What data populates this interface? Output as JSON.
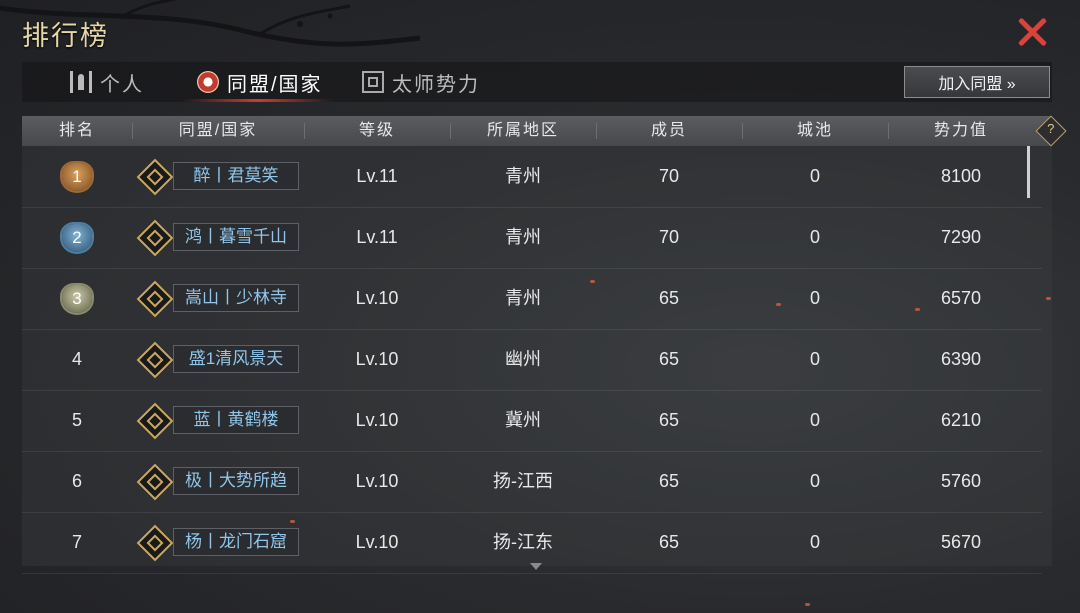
{
  "header": {
    "title": "排行榜"
  },
  "tabs": [
    {
      "label": "个人",
      "icon": "pagoda-icon",
      "active": false
    },
    {
      "label": "同盟/国家",
      "icon": "alliance-emblem-icon",
      "active": true
    },
    {
      "label": "太师势力",
      "icon": "seal-icon",
      "active": false
    }
  ],
  "join_button": {
    "label": "加入同盟 »"
  },
  "help": {
    "label": "?"
  },
  "columns": [
    "排名",
    "同盟/国家",
    "等级",
    "所属地区",
    "成员",
    "城池",
    "势力值"
  ],
  "rows": [
    {
      "rank": "1",
      "name": "醉丨君莫笑",
      "level": "Lv.11",
      "region": "青州",
      "members": "70",
      "cities": "0",
      "power": "8100"
    },
    {
      "rank": "2",
      "name": "鸿丨暮雪千山",
      "level": "Lv.11",
      "region": "青州",
      "members": "70",
      "cities": "0",
      "power": "7290"
    },
    {
      "rank": "3",
      "name": "嵩山丨少林寺",
      "level": "Lv.10",
      "region": "青州",
      "members": "65",
      "cities": "0",
      "power": "6570"
    },
    {
      "rank": "4",
      "name": "盛1清风景天",
      "level": "Lv.10",
      "region": "幽州",
      "members": "65",
      "cities": "0",
      "power": "6390"
    },
    {
      "rank": "5",
      "name": "蓝丨黄鹤楼",
      "level": "Lv.10",
      "region": "冀州",
      "members": "65",
      "cities": "0",
      "power": "6210"
    },
    {
      "rank": "6",
      "name": "极丨大势所趋",
      "level": "Lv.10",
      "region": "扬-江西",
      "members": "65",
      "cities": "0",
      "power": "5760"
    },
    {
      "rank": "7",
      "name": "杨丨龙门石窟",
      "level": "Lv.10",
      "region": "扬-江东",
      "members": "65",
      "cities": "0",
      "power": "5670"
    }
  ],
  "colors": {
    "title": "#e6d7a8",
    "close": "#d8433b",
    "name_text": "#8fc6ea",
    "active_tab_underline": "#d23a2d"
  }
}
